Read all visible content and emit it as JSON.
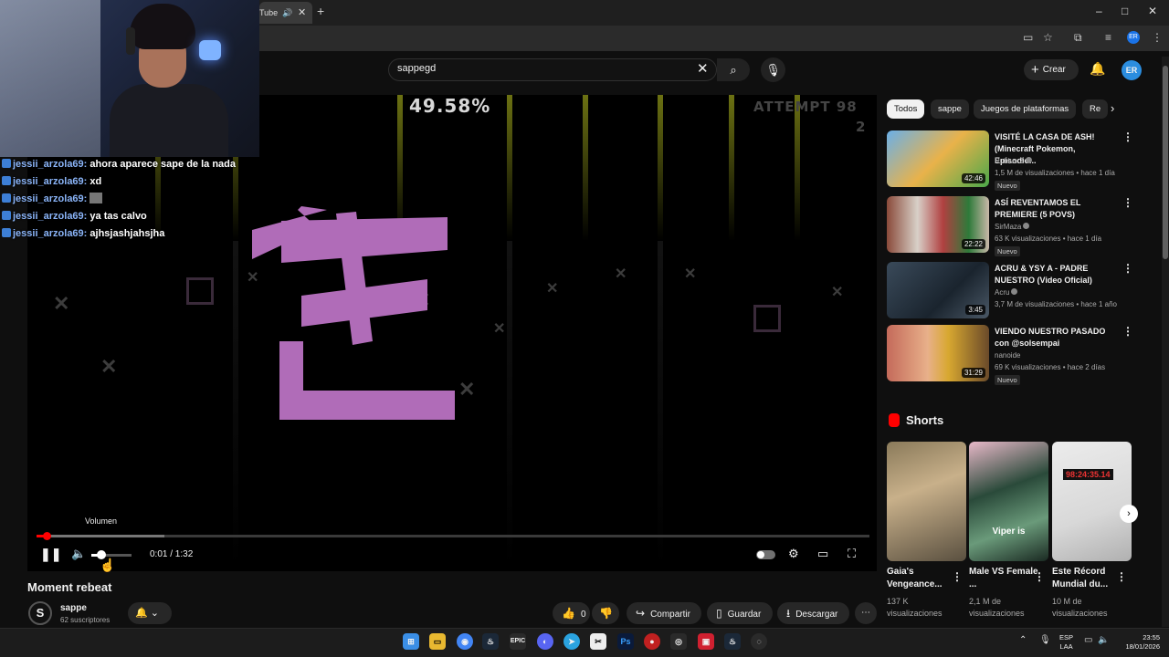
{
  "browser": {
    "tab_title": "Tube",
    "new_tab": "+",
    "window_controls": [
      "–",
      "□",
      "✕"
    ]
  },
  "header": {
    "search_value": "sappegd",
    "create_label": "Crear",
    "avatar_initials": "ER"
  },
  "player": {
    "game_percent": "49.58%",
    "game_attempt": "ATTEMPT 98",
    "game_attempt_line2": "2",
    "progress_fraction": 0.0119,
    "buffer_fraction": 0.153,
    "volume_fraction": 0.25,
    "volume_tooltip": "Volumen",
    "time": "0:01 / 1:32"
  },
  "video": {
    "title": "Moment rebeat",
    "channel_name": "sappe",
    "channel_subs": "62 suscriptores",
    "channel_initial": "S",
    "like_count": "0",
    "share_label": "Compartir",
    "save_label": "Guardar",
    "download_label": "Descargar"
  },
  "chat": [
    {
      "user": "jessii_arzola69:",
      "message": "ahora aparece sape de la nada"
    },
    {
      "user": "jessii_arzola69:",
      "message": "xd"
    },
    {
      "user": "jessii_arzola69:",
      "message": ""
    },
    {
      "user": "jessii_arzola69:",
      "message": "ya tas calvo"
    },
    {
      "user": "jessii_arzola69:",
      "message": "ajhsjashjahsjha"
    }
  ],
  "sidebar": {
    "chips": [
      "Todos",
      "sappe",
      "Juegos de plataformas",
      "Re"
    ],
    "recommendations": [
      {
        "title": "VISITÉ LA CASA DE ASH! (Minecraft Pokemon, Episodio...",
        "channel": "Rubius Z",
        "meta": "1,5 M de visualizaciones • hace 1 día",
        "duration": "42:46",
        "badge": "Nuevo"
      },
      {
        "title": "ASÍ REVENTAMOS EL PREMIERE (5 POVS)",
        "channel": "SirMaza",
        "meta": "63 K visualizaciones • hace 1 día",
        "duration": "22:22",
        "badge": "Nuevo"
      },
      {
        "title": "ACRU & YSY A - PADRE NUESTRO (Video Oficial)",
        "channel": "Acru",
        "meta": "3,7 M de visualizaciones • hace 1 año",
        "duration": "3:45",
        "badge": ""
      },
      {
        "title": "VIENDO NUESTRO PASADO con @solsempai",
        "channel": "nanoide",
        "meta": "69 K visualizaciones • hace 2 días",
        "duration": "31:29",
        "badge": "Nuevo"
      }
    ],
    "shorts_heading": "Shorts",
    "shorts": [
      {
        "title": "Gaia's Vengeance...",
        "views": "137 K visualizaciones",
        "overlay": ""
      },
      {
        "title": "Male VS Female ...",
        "views": "2,1 M de visualizaciones",
        "overlay": "Viper is"
      },
      {
        "title": "Este Récord Mundial du...",
        "views": "10 M de visualizaciones",
        "overlay": "98:24:35.14"
      }
    ]
  },
  "taskbar": {
    "lang_line1": "ESP",
    "lang_line2": "LAA",
    "time": "23:55",
    "date": "18/01/2026"
  },
  "colors": {
    "accent": "#ff0000",
    "background": "#0f0f0f",
    "chip_bg": "#272727",
    "chat_user": "#8ab4f8",
    "game_glyph": "#b06cb8"
  }
}
